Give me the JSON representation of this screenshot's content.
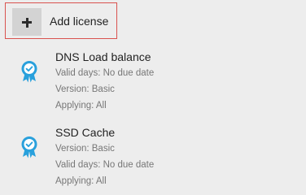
{
  "add_license": {
    "label": "Add license",
    "icon": "plus-icon"
  },
  "colors": {
    "accent_border": "#d9534f",
    "badge_blue": "#29a0dc",
    "background": "#ededed"
  },
  "licenses": [
    {
      "name": "DNS Load balance",
      "icon": "badge-check-icon",
      "details": [
        "Valid days: No due date",
        "Version: Basic",
        "Applying: All"
      ]
    },
    {
      "name": "SSD Cache",
      "icon": "badge-check-icon",
      "details": [
        "Version: Basic",
        "Valid days: No due date",
        "Applying: All"
      ]
    }
  ]
}
